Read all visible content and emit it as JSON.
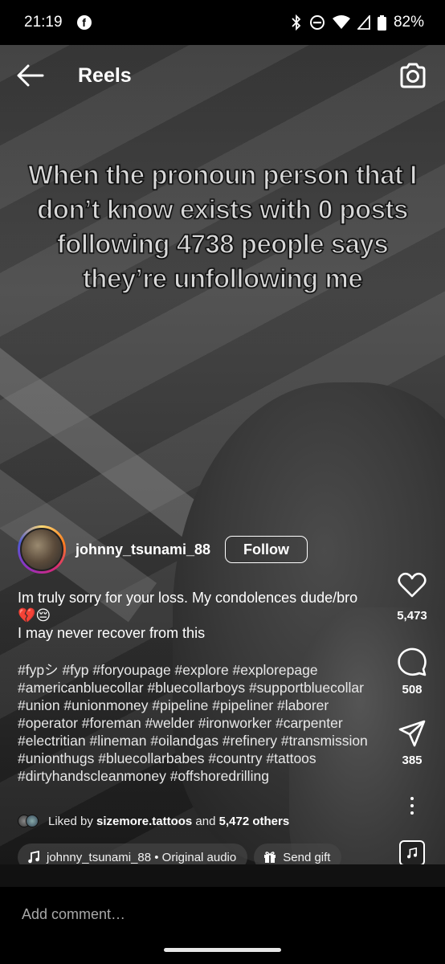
{
  "status_bar": {
    "time": "21:19",
    "notification_icon": "facebook-icon",
    "icons": [
      "bluetooth-icon",
      "do-not-disturb-icon",
      "wifi-icon",
      "signal-icon",
      "battery-icon"
    ],
    "battery": "82%"
  },
  "header": {
    "title": "Reels",
    "back_icon": "arrow-left-icon",
    "camera_icon": "camera-icon"
  },
  "video": {
    "overlay_text": "When the pronoun person that I don’t know exists with 0 posts following 4738 people says they’re unfollowing me"
  },
  "post": {
    "username": "johnny_tsunami_88",
    "follow_label": "Follow",
    "caption_line1": "Im truly sorry for your loss. My condolences dude/bro",
    "caption_emojis": "💔😔",
    "caption_line3": "I may never recover from this",
    "hashtags": "#fypシ #fyp #foryoupage #explore #explorepage #americanbluecollar #bluecollarboys #supportbluecollar #union #unionmoney #pipeline #pipeliner #laborer #operator #foreman #welder #ironworker #carpenter #electritian #lineman #oilandgas #refinery #transmission #unionthugs #bluecollarbabes #country #tattoos #dirtyhandscleanmoney #offshoredrilling",
    "liked_by_prefix": "Liked by",
    "liked_by_user": "sizemore.tattoos",
    "liked_by_and": "and",
    "liked_by_others": "5,472 others",
    "audio_label": "johnny_tsunami_88 • Original audio",
    "gift_label": "Send gift"
  },
  "actions": {
    "likes": "5,473",
    "comments": "508",
    "shares": "385"
  },
  "comment": {
    "placeholder": "Add comment…"
  }
}
